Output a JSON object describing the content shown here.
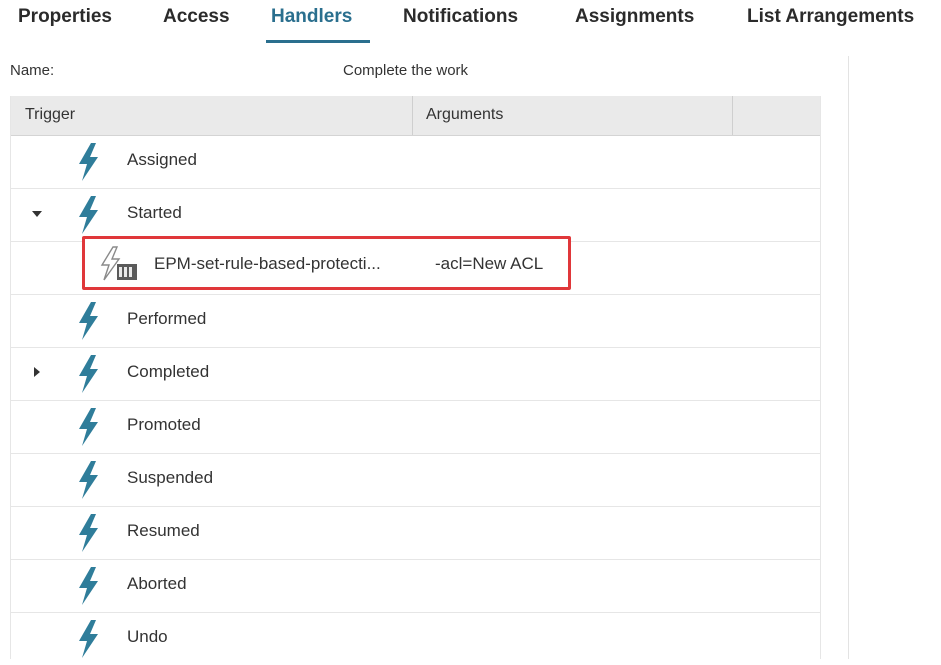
{
  "tabs": [
    {
      "label": "Properties",
      "active": false
    },
    {
      "label": "Access",
      "active": false
    },
    {
      "label": "Handlers",
      "active": true
    },
    {
      "label": "Notifications",
      "active": false
    },
    {
      "label": "Assignments",
      "active": false
    },
    {
      "label": "List Arrangements",
      "active": false
    }
  ],
  "name_label": "Name:",
  "name_value": "Complete the work",
  "grid": {
    "columns": {
      "trigger": "Trigger",
      "arguments": "Arguments"
    },
    "rows": [
      {
        "label": "Assigned",
        "expander": "none"
      },
      {
        "label": "Started",
        "expander": "expanded"
      },
      {
        "label": "",
        "expander": "none"
      },
      {
        "label": "Performed",
        "expander": "none"
      },
      {
        "label": "Completed",
        "expander": "collapsed"
      },
      {
        "label": "Promoted",
        "expander": "none"
      },
      {
        "label": "Suspended",
        "expander": "none"
      },
      {
        "label": "Resumed",
        "expander": "none"
      },
      {
        "label": "Aborted",
        "expander": "none"
      },
      {
        "label": "Undo",
        "expander": "none"
      }
    ],
    "handler": {
      "name": "EPM-set-rule-based-protecti...",
      "arguments": "-acl=New ACL",
      "icon": "handler-bolt-icon"
    }
  },
  "colors": {
    "active_tab": "#2a6f8e",
    "bolt": "#2f7d9a",
    "highlight_border": "#e0373a"
  }
}
